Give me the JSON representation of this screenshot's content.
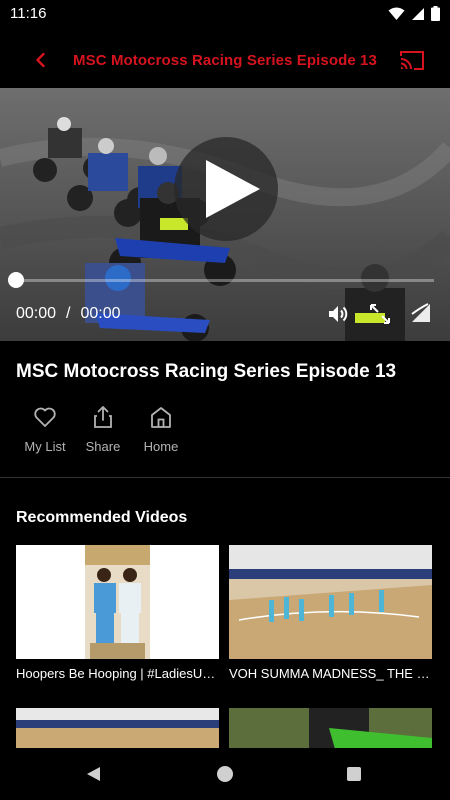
{
  "status_bar": {
    "time": "11:16",
    "icons": [
      "wifi-icon",
      "signal-icon",
      "battery-icon"
    ]
  },
  "app_bar": {
    "title": "MSC Motocross Racing Series Episode 13",
    "back_icon": "chevron-left-icon",
    "cast_icon": "cast-icon",
    "accent_color": "#d6141f"
  },
  "player": {
    "current_time": "00:00",
    "separator": "/",
    "duration": "00:00",
    "progress": 0,
    "controls": [
      "play-icon",
      "volume-icon",
      "fullscreen-icon",
      "pip-icon"
    ]
  },
  "video": {
    "title": "MSC Motocross Racing Series Episode 13"
  },
  "actions": [
    {
      "label": "My List",
      "icon": "heart-icon"
    },
    {
      "label": "Share",
      "icon": "share-icon"
    },
    {
      "label": "Home",
      "icon": "home-icon"
    }
  ],
  "recommended": {
    "heading": "Recommended Videos",
    "items": [
      {
        "caption": "Hoopers Be Hooping | #LadiesUnl..."
      },
      {
        "caption": "VOH SUMMA MADNESS_ THE 84..."
      },
      {
        "caption": ""
      },
      {
        "caption": ""
      }
    ]
  },
  "nav_bar": {
    "icons": [
      "back-triangle-icon",
      "home-circle-icon",
      "recents-square-icon"
    ]
  }
}
